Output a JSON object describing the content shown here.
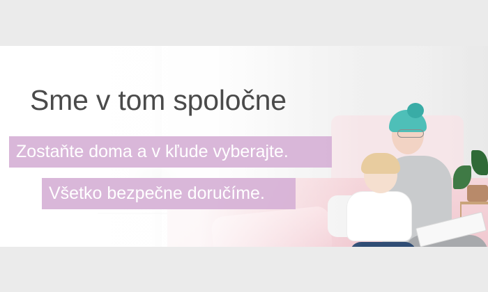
{
  "banner": {
    "headline": "Sme v tom spoločne",
    "tagline_1": "Zostaňte doma a v kľude vyberajte.",
    "tagline_2": "Všetko bezpečne doručíme."
  },
  "colors": {
    "page_background": "#ebebeb",
    "headline_text": "#4a4a4a",
    "tagline_background": "#d6b1d6",
    "tagline_text": "#ffffff"
  }
}
